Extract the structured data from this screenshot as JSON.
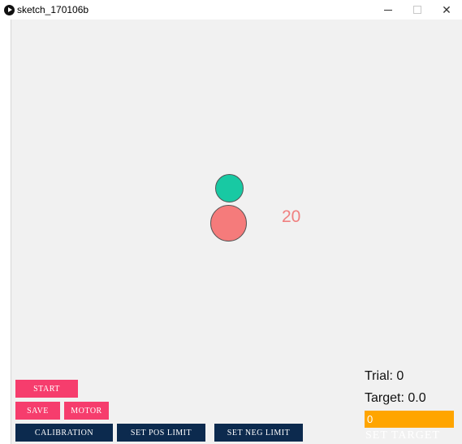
{
  "window": {
    "title": "sketch_170106b",
    "controls": [
      "minimize",
      "maximize",
      "close"
    ],
    "close_glyph": "✕"
  },
  "sketch": {
    "counter": "20",
    "colors": {
      "background": "#f1f1f1",
      "green_ball": "#18c9a3",
      "red_ball": "#f57b7b",
      "counter_text": "#f08080",
      "pink_button": "#f63d6d",
      "navy_button": "#0c2a4e",
      "target_field": "#ffa500"
    },
    "buttons": {
      "start": "START",
      "save": "SAVE",
      "motor": "MOTOR",
      "calibration": "CALIBRATION",
      "set_pos_limit": "SET POS LIMIT",
      "set_neg_limit": "SET NEG LIMIT"
    },
    "trial_text": "Trial: 0",
    "target_text": "Target: 0.0",
    "target_input_value": "0",
    "set_target_label": "SET TARGET"
  }
}
